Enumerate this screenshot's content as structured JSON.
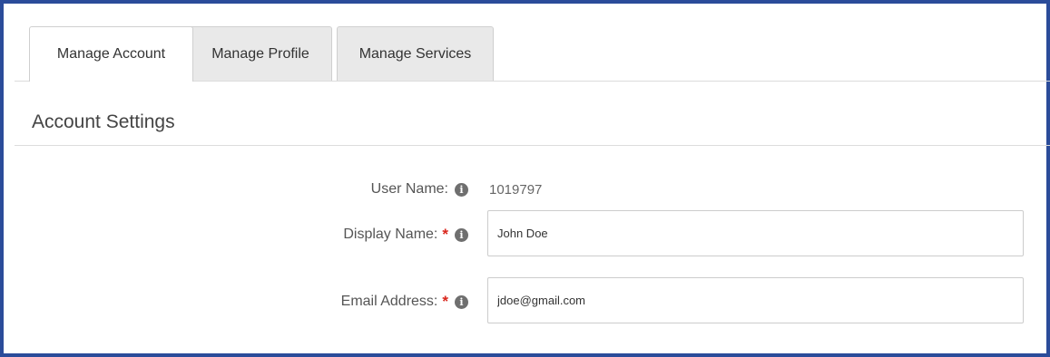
{
  "tabs": [
    {
      "label": "Manage Account",
      "active": true
    },
    {
      "label": "Manage Profile",
      "active": false
    },
    {
      "label": "Manage Services",
      "active": false
    }
  ],
  "section": {
    "title": "Account Settings"
  },
  "fields": {
    "user_name": {
      "label": "User Name:",
      "value": "1019797",
      "required": false
    },
    "display_name": {
      "label": "Display Name:",
      "value": "John Doe",
      "required": true,
      "required_mark": "*"
    },
    "email_address": {
      "label": "Email Address:",
      "value": "jdoe@gmail.com",
      "required": true,
      "required_mark": "*"
    }
  },
  "icons": {
    "info_glyph": "i"
  },
  "colors": {
    "frame_border": "#2b4c9a",
    "required_star": "#d9261c",
    "inactive_tab": "#e9e9e9"
  }
}
